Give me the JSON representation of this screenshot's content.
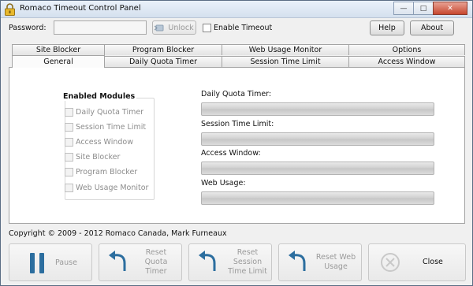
{
  "window": {
    "title": "Romaco Timeout Control Panel",
    "controls": [
      "—",
      "□",
      "✕"
    ]
  },
  "header": {
    "password_label": "Password:",
    "password_value": "",
    "unlock_label": "Unlock",
    "enable_timeout_label": "Enable Timeout",
    "enable_timeout_checked": false,
    "help_label": "Help",
    "about_label": "About"
  },
  "tabs": {
    "row1": [
      "Site Blocker",
      "Program Blocker",
      "Web Usage Monitor",
      "Options"
    ],
    "row2": [
      "General",
      "Daily Quota Timer",
      "Session Time Limit",
      "Access Window"
    ],
    "active": "General"
  },
  "general": {
    "modules_title": "Enabled Modules",
    "modules": [
      {
        "label": "Daily Quota Timer",
        "checked": false
      },
      {
        "label": "Session Time Limit",
        "checked": false
      },
      {
        "label": "Access Window",
        "checked": false
      },
      {
        "label": "Site Blocker",
        "checked": false
      },
      {
        "label": "Program Blocker",
        "checked": false
      },
      {
        "label": "Web Usage Monitor",
        "checked": false
      }
    ],
    "status": [
      {
        "label": "Daily Quota Timer:",
        "progress": 0
      },
      {
        "label": "Session Time Limit:",
        "progress": 0
      },
      {
        "label": "Access Window:",
        "progress": 0
      },
      {
        "label": "Web Usage:",
        "progress": 0
      }
    ]
  },
  "copyright": "Copyright © 2009 - 2012 Romaco Canada, Mark Furneaux",
  "actions": {
    "pause": "Pause",
    "reset_quota": "Reset Quota Timer",
    "reset_session": "Reset Session Time Limit",
    "reset_web": "Reset Web Usage",
    "close": "Close"
  },
  "colors": {
    "accent_icon": "#2c6e9f",
    "disabled_text": "#9a9a9a"
  }
}
